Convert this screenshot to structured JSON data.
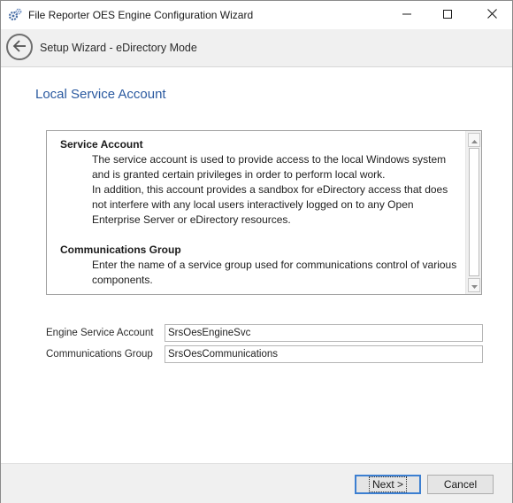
{
  "window": {
    "title": "File Reporter OES Engine Configuration Wizard",
    "icon": "gears-icon",
    "controls": [
      "minimize-icon",
      "maximize-icon",
      "close-icon"
    ]
  },
  "nav": {
    "back_icon": "arrow-left-icon",
    "title": "Setup Wizard - eDirectory Mode"
  },
  "page": {
    "title": "Local Service Account"
  },
  "info": {
    "sections": [
      {
        "heading": "Service Account",
        "lines": [
          "The service account is used to provide access to the local Windows system",
          "and is granted certain privileges in order to perform local work.",
          "In addition, this account provides a sandbox for eDirectory access that does",
          "not interfere with any local users interactively logged on to any Open",
          "Enterprise Server or eDirectory resources."
        ]
      },
      {
        "heading": "Communications Group",
        "lines": [
          "Enter the name of a service group used for communications control of various",
          "components."
        ]
      }
    ]
  },
  "fields": {
    "engine_service_account": {
      "label": "Engine Service Account",
      "value": "SrsOesEngineSvc"
    },
    "communications_group": {
      "label": "Communications Group",
      "value": "SrsOesCommunications"
    }
  },
  "footer": {
    "next_label": "Next >",
    "cancel_label": "Cancel"
  },
  "colors": {
    "accent": "#2b5aa0",
    "focus_border": "#3c7fd1",
    "nav_background": "#f0f0f0"
  }
}
